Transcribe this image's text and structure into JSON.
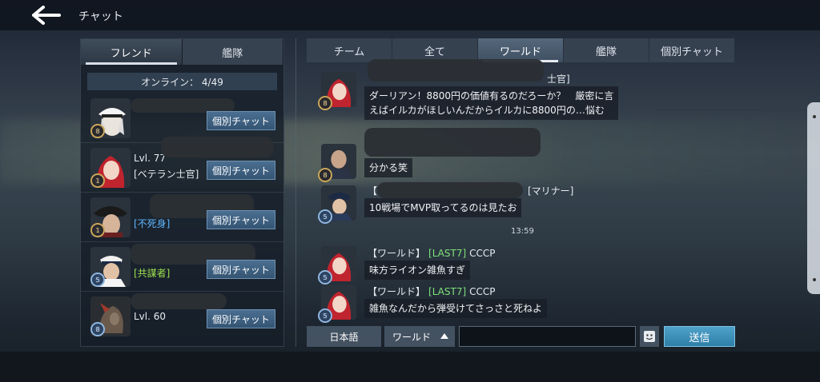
{
  "header": {
    "title": "チャット"
  },
  "left_panel": {
    "tabs": [
      {
        "label": "フレンド",
        "active": true
      },
      {
        "label": "艦隊",
        "active": false
      }
    ],
    "online_label": "オンライン： 4/49",
    "friends": [
      {
        "level": "",
        "title": "",
        "title_color": "",
        "pm_label": "個別チャット",
        "avatar": "white-cap-captain-avatar",
        "badge": "8"
      },
      {
        "level": "Lvl. 77",
        "title": "[ベテラン士官]",
        "title_color": "",
        "pm_label": "個別チャット",
        "avatar": "red-hair-girl-avatar",
        "badge": "1"
      },
      {
        "level": "",
        "title": "[不死身]",
        "title_color": "blue",
        "pm_label": "個別チャット",
        "avatar": "bicorne-admiral-avatar",
        "badge": "1"
      },
      {
        "level": "",
        "title": "[共謀者]",
        "title_color": "green",
        "pm_label": "個別チャット",
        "avatar": "navy-officer-avatar",
        "badge": "5"
      },
      {
        "level": "Lvl. 60",
        "title": "",
        "title_color": "",
        "pm_label": "個別チャット",
        "avatar": "creature-avatar",
        "badge": "8"
      }
    ]
  },
  "right_panel": {
    "tabs": [
      {
        "label": "チーム",
        "active": false
      },
      {
        "label": "全て",
        "active": false
      },
      {
        "label": "ワールド",
        "active": true
      },
      {
        "label": "艦隊",
        "active": false
      },
      {
        "label": "個別チャット",
        "active": false
      }
    ],
    "messages": [
      {
        "sender_suffix": "士官]",
        "text_line1": "ダーリアン！8800円の価値有るのだろーか？　厳密に言",
        "text_line2": "えばイルカがほしいんだからイルカに8800円の…悩む",
        "avatar": "red-hair-girl-avatar",
        "badge": "8"
      },
      {
        "text": "分かる笑",
        "avatar": "bald-officer-avatar",
        "badge": "8"
      },
      {
        "sender_prefix": "【",
        "sender_suffix": "[マリナー]",
        "text": "10戦場でMVP取ってるのは見たお",
        "avatar": "navy-officer-avatar",
        "badge": "5"
      },
      {
        "timestamp": "13:59"
      },
      {
        "category": "【ワールド】",
        "clan": "[LAST7]",
        "name": "CCCP",
        "text": "味方ライオン雑魚すぎ",
        "avatar": "red-hair-girl-avatar",
        "badge": "5"
      },
      {
        "category": "【ワールド】",
        "clan": "[LAST7]",
        "name": "CCCP",
        "text": "雑魚なんだから弾受けてさっさと死ねよ",
        "avatar": "red-hair-girl-avatar",
        "badge": "5"
      }
    ]
  },
  "input_bar": {
    "language_label": "日本語",
    "channel_label": "ワールド",
    "input_value": "",
    "input_placeholder": "",
    "send_label": "送信"
  },
  "colors": {
    "accent_send": "#2f7fa8",
    "clan_tag": "#7fe27a",
    "title_blue": "#5fb6ff",
    "title_green": "#9fe24f"
  }
}
